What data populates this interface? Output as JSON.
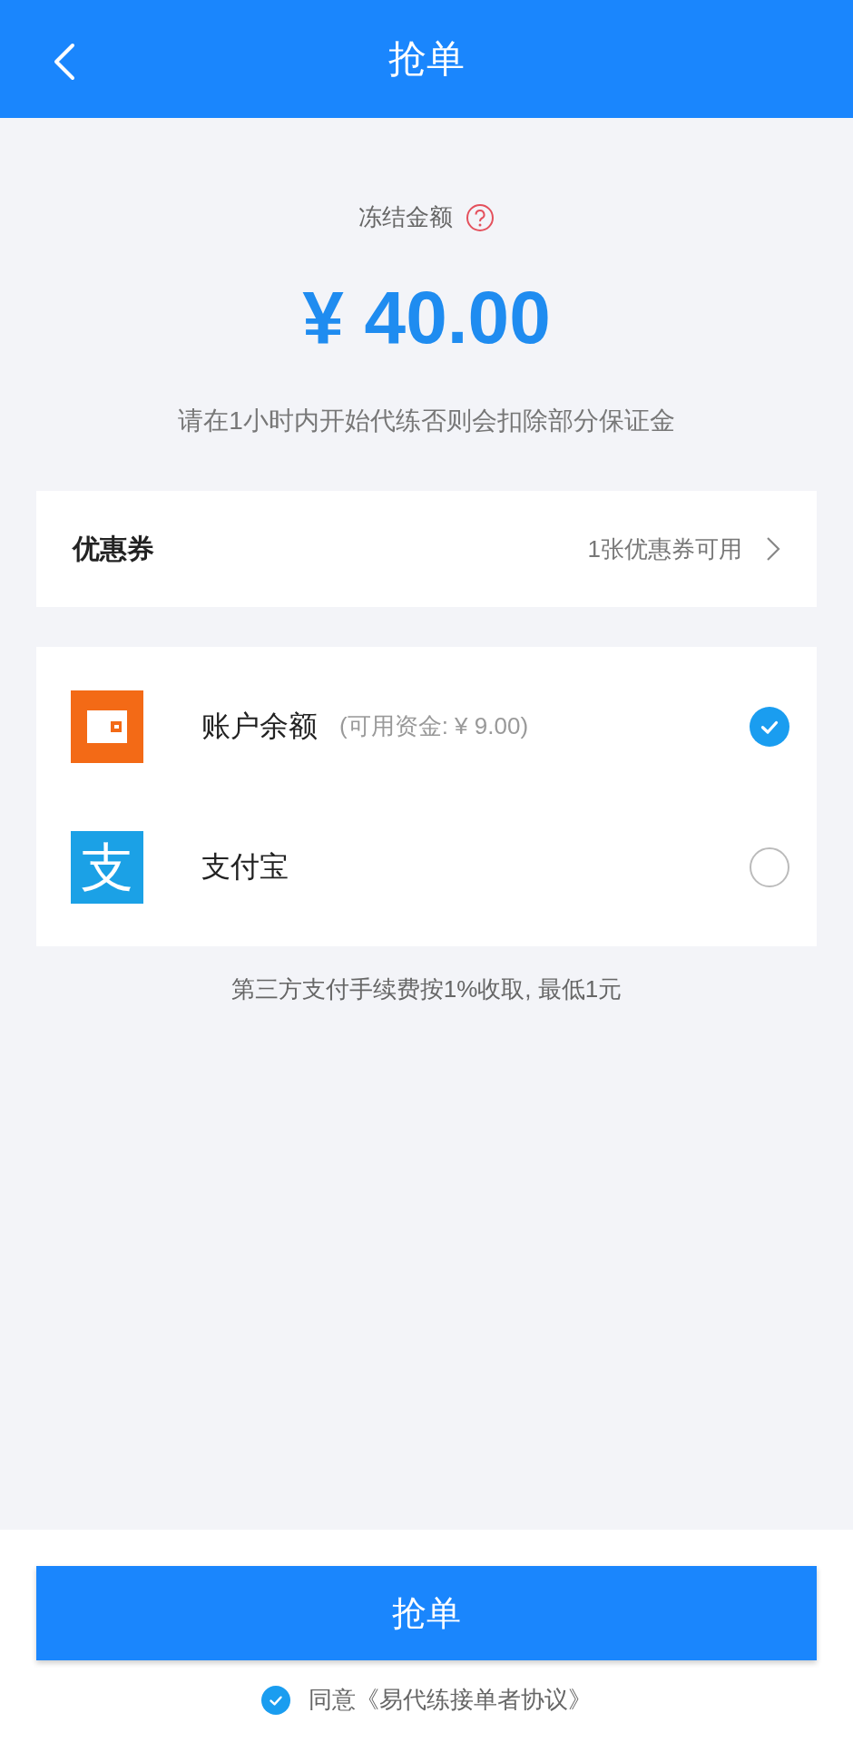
{
  "header": {
    "title": "抢单"
  },
  "frozen": {
    "label": "冻结金额",
    "amount": "¥ 40.00",
    "note": "请在1小时内开始代练否则会扣除部分保证金"
  },
  "coupon": {
    "label": "优惠券",
    "value": "1张优惠券可用"
  },
  "payment_methods": [
    {
      "kind": "balance",
      "label": "账户余额",
      "detail": "(可用资金: ¥ 9.00)",
      "selected": true
    },
    {
      "kind": "alipay",
      "logo_text": "支",
      "label": "支付宝",
      "selected": false
    }
  ],
  "fee_note": "第三方支付手续费按1%收取, 最低1元",
  "submit_button": "抢单",
  "agreement": {
    "checked": true,
    "text": "同意《易代练接单者协议》"
  }
}
